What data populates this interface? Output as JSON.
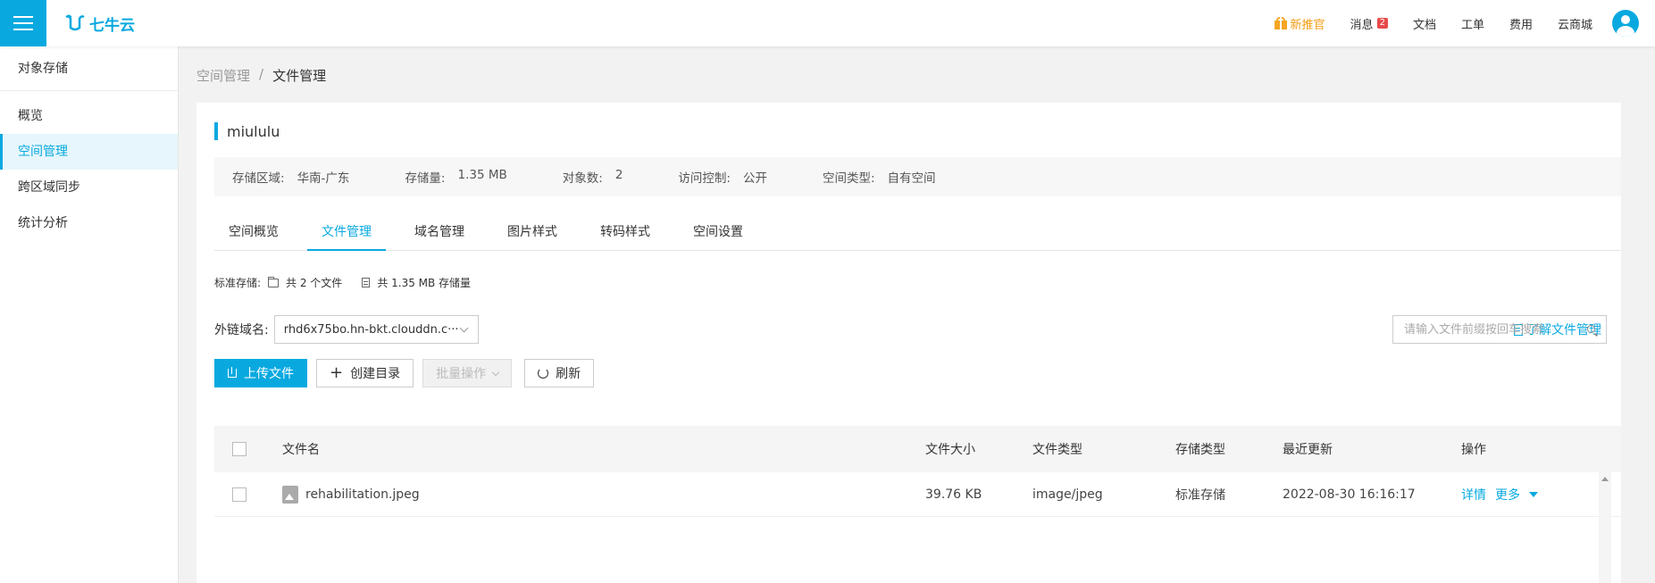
{
  "colors": {
    "accent": "#09a9e0",
    "promo": "#f39c12",
    "badge": "#e94a4a"
  },
  "header": {
    "logo_text": "七牛云",
    "nav": [
      {
        "label": "新推官",
        "icon": "gift-icon"
      },
      {
        "label": "消息",
        "badge": "2"
      },
      {
        "label": "文档"
      },
      {
        "label": "工单"
      },
      {
        "label": "费用"
      },
      {
        "label": "云商城"
      }
    ]
  },
  "sidebar": {
    "title": "对象存储",
    "items": [
      {
        "label": "概览"
      },
      {
        "label": "空间管理",
        "active": true
      },
      {
        "label": "跨区域同步"
      },
      {
        "label": "统计分析"
      }
    ]
  },
  "breadcrumb": {
    "parent": "空间管理",
    "separator": "/",
    "current": "文件管理"
  },
  "bucket": {
    "name": "miululu",
    "info": [
      {
        "label": "存储区域:",
        "value": "华南-广东"
      },
      {
        "label": "存储量:",
        "value": "1.35 MB"
      },
      {
        "label": "对象数:",
        "value": "2"
      },
      {
        "label": "访问控制:",
        "value": "公开"
      },
      {
        "label": "空间类型:",
        "value": "自有空间"
      }
    ]
  },
  "tabs": [
    {
      "label": "空间概览"
    },
    {
      "label": "文件管理",
      "active": true
    },
    {
      "label": "域名管理"
    },
    {
      "label": "图片样式"
    },
    {
      "label": "转码样式"
    },
    {
      "label": "空间设置"
    }
  ],
  "stats": {
    "label": "标准存储:",
    "files": "共 2 个文件",
    "storage": "共 1.35 MB 存储量"
  },
  "domain": {
    "label": "外链域名:",
    "selected": "rhd6x75bo.hn-bkt.clouddn.c···"
  },
  "learn_link": "了解文件管理",
  "actions": {
    "upload": "上传文件",
    "mkdir": "创建目录",
    "batch": "批量操作",
    "refresh": "刷新"
  },
  "search": {
    "placeholder": "请输入文件前缀按回车搜索"
  },
  "table": {
    "headers": {
      "name": "文件名",
      "size": "文件大小",
      "type": "文件类型",
      "storage": "存储类型",
      "updated": "最近更新",
      "ops": "操作"
    },
    "rows": [
      {
        "name": "rehabilitation.jpeg",
        "size": "39.76 KB",
        "type": "image/jpeg",
        "storage": "标准存储",
        "updated": "2022-08-30 16:16:17",
        "op_detail": "详情",
        "op_more": "更多"
      }
    ]
  }
}
